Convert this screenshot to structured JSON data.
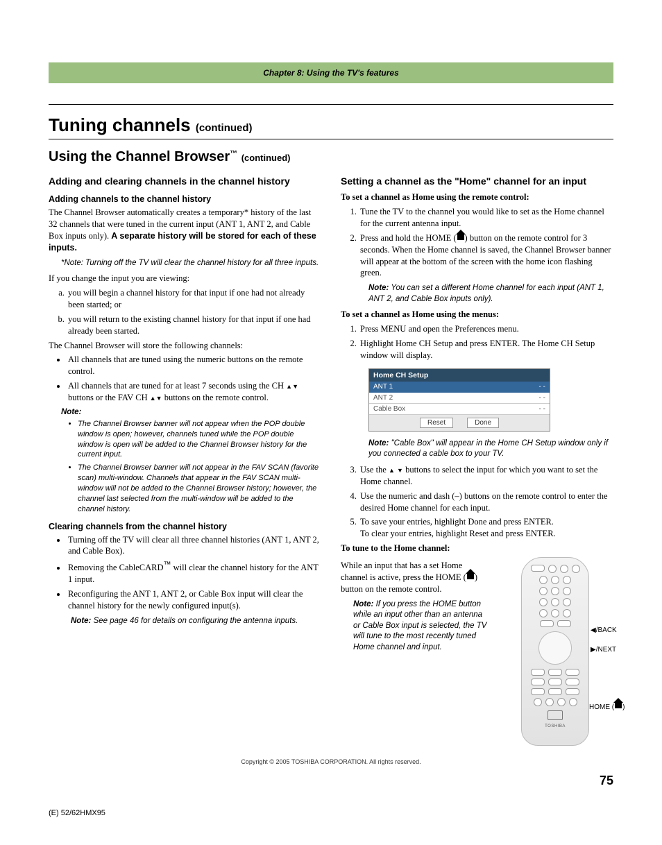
{
  "chapter_bar": "Chapter 8: Using the TV's features",
  "h1_main": "Tuning channels",
  "h1_cont": "(continued)",
  "h2_main": "Using the Channel Browser",
  "h2_tm": "™",
  "h2_cont": "(continued)",
  "left": {
    "h3a": "Adding and clearing channels in the channel history",
    "h4a": "Adding channels to the channel history",
    "p1a": "The Channel Browser automatically creates a temporary* history of the last 32 channels that were tuned in the current input (ANT 1, ANT 2, and Cable Box inputs only). ",
    "p1b": "A separate history will be stored for each of these inputs.",
    "note1": "*Note: Turning off the TV will clear the channel history for all three inputs.",
    "p2": "If you change the input you are viewing:",
    "li_a": "you will begin a channel history for that input if one had not already been started; or",
    "li_b": "you will return to the existing channel history for that input if one had already been started.",
    "p3": "The Channel Browser will store the following channels:",
    "ul1_1": "All channels that are tuned using the numeric buttons on the remote control.",
    "ul1_2a": "All channels that are tuned for at least 7 seconds using the CH ",
    "ul1_2b": " buttons or the FAV CH ",
    "ul1_2c": " buttons on the remote control.",
    "note2_head": "Note:",
    "note2_li1": "The Channel Browser banner will not appear when the POP double window is open; however, channels tuned while the POP double window is open will be added to the Channel Browser history for the current input.",
    "note2_li2": "The Channel Browser banner will not appear in the FAV SCAN (favorite scan) multi-window. Channels that appear in the FAV SCAN multi-window will not be added to the Channel Browser history; however, the channel last selected from the multi-window will be added to the channel history.",
    "h4b": "Clearing channels from the channel history",
    "ul2_1": "Turning off the TV will clear all three channel histories (ANT 1, ANT 2, and Cable Box).",
    "ul2_2a": "Removing the CableCARD",
    "ul2_2b": " will clear the channel history for the ANT 1 input.",
    "ul2_3": "Reconfiguring the ANT 1, ANT 2, or Cable Box input will clear the channel history for the newly configured input(s).",
    "note3_label": "Note:",
    "note3_text": " See page 46 for details on configuring the antenna inputs."
  },
  "right": {
    "h3a": "Setting a channel as the \"Home\" channel for an input",
    "b1": "To set a channel as Home using the remote control:",
    "ol1_1": "Tune the TV to the channel you would like to set as the Home channel for the current antenna input.",
    "ol1_2a": "Press and hold the HOME (",
    "ol1_2b": ") button on the remote control for 3 seconds. When the Home channel is saved, the Channel Browser banner will appear at the bottom of the screen with the home icon flashing green.",
    "note1_label": "Note:",
    "note1_text": " You can set a different Home channel for each input (ANT 1, ANT 2, and Cable Box inputs only).",
    "b2": "To set a channel as Home using the menus:",
    "ol2_1": "Press MENU and open the Preferences menu.",
    "ol2_2": "Highlight Home CH Setup and press ENTER.  The Home CH Setup window will display.",
    "hcs_title": "Home CH Setup",
    "hcs_rows": [
      {
        "label": "ANT 1",
        "val": "- -",
        "sel": true
      },
      {
        "label": "ANT 2",
        "val": "- -",
        "sel": false
      },
      {
        "label": "Cable Box",
        "val": "- -",
        "sel": false
      }
    ],
    "hcs_reset": "Reset",
    "hcs_done": "Done",
    "note2_label": "Note:",
    "note2_text": " \"Cable Box\" will appear in the Home CH Setup window only if you connected a cable box to your TV.",
    "ol3_3a": "Use the ",
    "ol3_3b": " buttons to select the input for which you want to set the Home channel.",
    "ol3_4": "Use the numeric and dash (–) buttons on the remote control to enter the desired Home channel for each input.",
    "ol3_5a": "To save your entries, highlight Done and press ENTER.",
    "ol3_5b": "To clear your entries, highlight Reset and press ENTER.",
    "b3": "To tune to the Home channel:",
    "p_tune_a": "While an input that has a set Home channel is active, press the HOME (",
    "p_tune_b": ") button on the remote control.",
    "note3_label": "Note:",
    "note3_text": " If you press the HOME button while an input other than an antenna or Cable Box input is selected, the TV will tune to the most recently tuned Home channel and input.",
    "remote_label_back": "/BACK",
    "remote_label_next": "/NEXT",
    "remote_label_home": "HOME (",
    "remote_label_home_end": ")",
    "toshiba": "TOSHIBA"
  },
  "footer": "Copyright © 2005 TOSHIBA CORPORATION. All rights reserved.",
  "page_number": "75",
  "bleed": "(E) 52/62HMX95"
}
